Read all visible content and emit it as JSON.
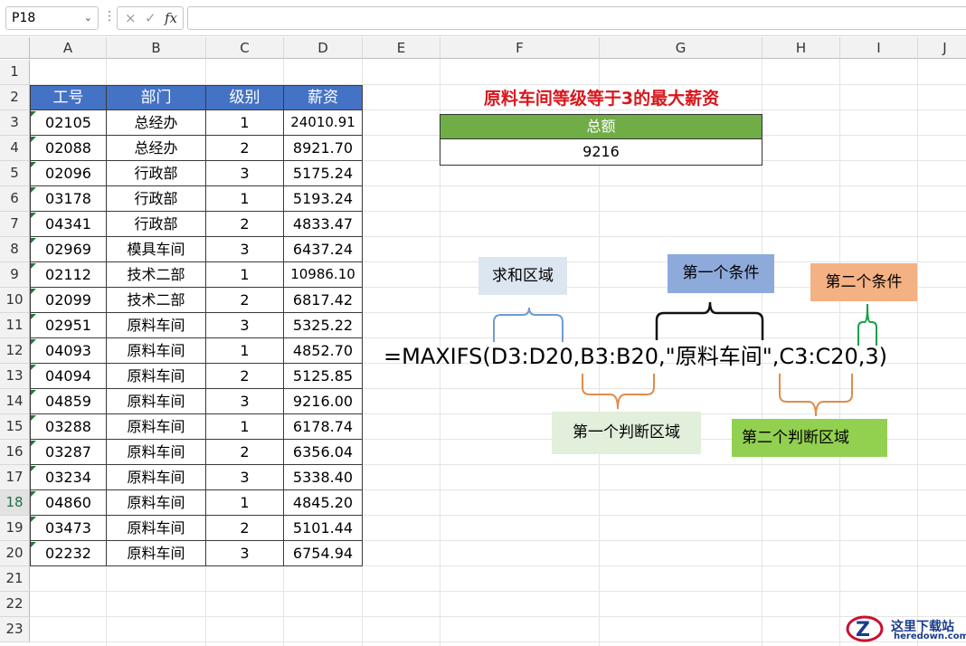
{
  "formula_bar": {
    "name_box": "P18",
    "cancel_icon": "×",
    "enter_icon": "✓",
    "fx_label": "fx",
    "formula": ""
  },
  "columns": [
    "A",
    "B",
    "C",
    "D",
    "E",
    "F",
    "G",
    "H",
    "I",
    "J"
  ],
  "rows": [
    "1",
    "2",
    "3",
    "4",
    "5",
    "6",
    "7",
    "8",
    "9",
    "10",
    "11",
    "12",
    "13",
    "14",
    "15",
    "16",
    "17",
    "18",
    "19",
    "20",
    "21",
    "22",
    "23"
  ],
  "selected_row": "18",
  "table": {
    "headers": [
      "工号",
      "部门",
      "级别",
      "薪资"
    ],
    "rows": [
      [
        "02105",
        "总经办",
        "1",
        "24010.91"
      ],
      [
        "02088",
        "总经办",
        "2",
        "8921.70"
      ],
      [
        "02096",
        "行政部",
        "3",
        "5175.24"
      ],
      [
        "03178",
        "行政部",
        "1",
        "5193.24"
      ],
      [
        "04341",
        "行政部",
        "2",
        "4833.47"
      ],
      [
        "02969",
        "模具车间",
        "3",
        "6437.24"
      ],
      [
        "02112",
        "技术二部",
        "1",
        "10986.10"
      ],
      [
        "02099",
        "技术二部",
        "2",
        "6817.42"
      ],
      [
        "02951",
        "原料车间",
        "3",
        "5325.22"
      ],
      [
        "04093",
        "原料车间",
        "1",
        "4852.70"
      ],
      [
        "04094",
        "原料车间",
        "2",
        "5125.85"
      ],
      [
        "04859",
        "原料车间",
        "3",
        "9216.00"
      ],
      [
        "03288",
        "原料车间",
        "1",
        "6178.74"
      ],
      [
        "03287",
        "原料车间",
        "2",
        "6356.04"
      ],
      [
        "03234",
        "原料车间",
        "3",
        "5338.40"
      ],
      [
        "04860",
        "原料车间",
        "1",
        "4845.20"
      ],
      [
        "03473",
        "原料车间",
        "2",
        "5101.44"
      ],
      [
        "02232",
        "原料车间",
        "3",
        "6754.94"
      ]
    ]
  },
  "summary": {
    "title": "原料车间等级等于3的最大薪资",
    "header": "总额",
    "value": "9216"
  },
  "annotations": {
    "formula": "=MAXIFS(D3:D20,B3:B20,\"原料车间\",C3:C20,3)",
    "sum_range": "求和区域",
    "criteria1": "第一个条件",
    "criteria2": "第二个条件",
    "criteria_range1": "第一个判断区域",
    "criteria_range2": "第二个判断区域"
  },
  "colors": {
    "header_blue": "#4472c4",
    "summary_green": "#70ad47",
    "title_red": "#d9161c",
    "sum_range_bg": "#dce6f1",
    "criteria1_bg": "#8eaadb",
    "criteria2_bg": "#f4b183",
    "criteria_range1_bg": "#e2efda",
    "criteria_range2_bg": "#92d050"
  },
  "watermark": {
    "site_name": "这里下载站",
    "site_url": "heredown.com"
  }
}
